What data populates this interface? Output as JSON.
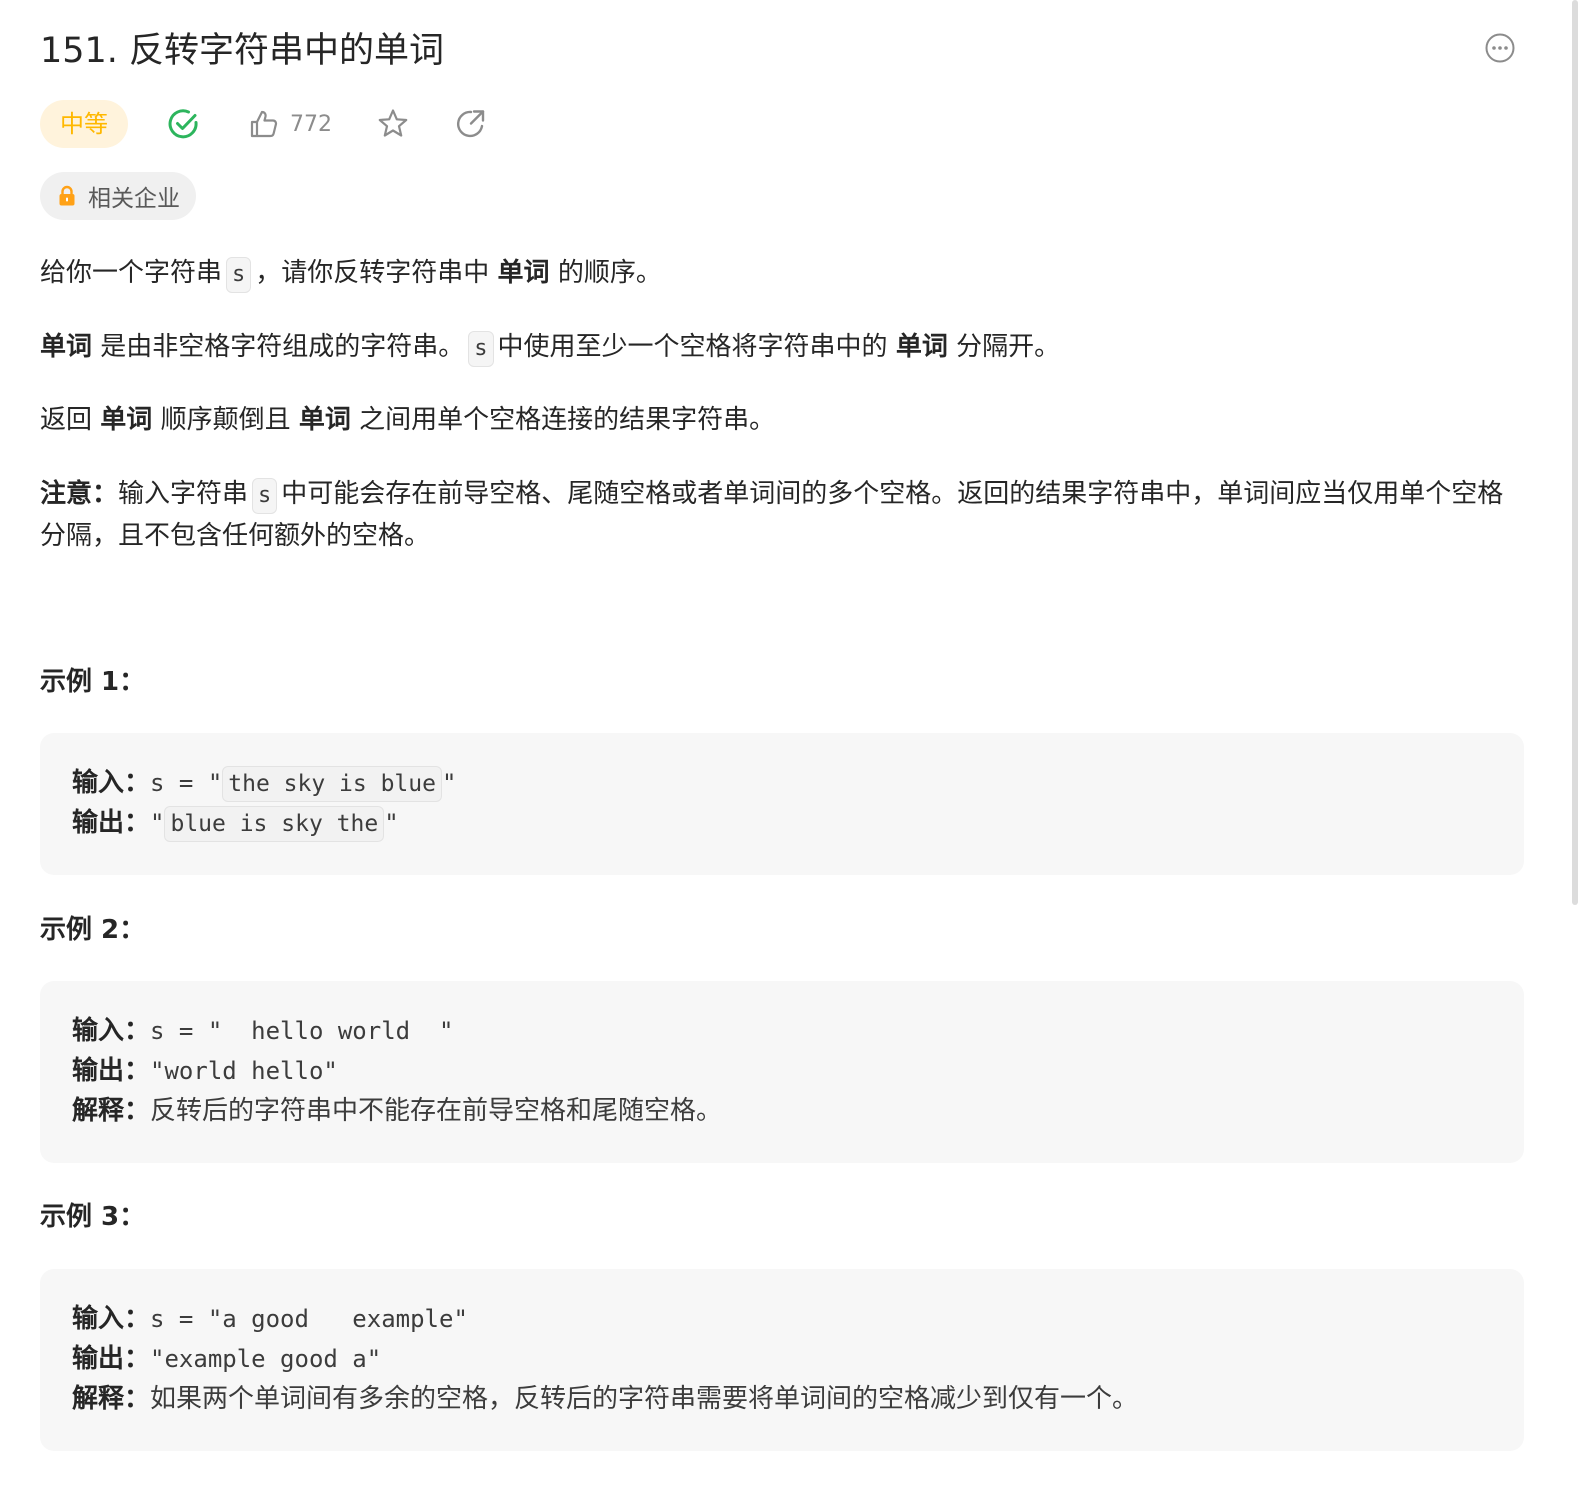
{
  "problem": {
    "title": "151. 反转字符串中的单词",
    "difficulty": "中等",
    "likes": "772",
    "company_tag": "相关企业"
  },
  "description": {
    "p1": {
      "a": "给你一个字符串",
      "code": "s",
      "b": "，请你反转字符串中",
      "bold": "单词",
      "c": "的顺序。"
    },
    "p2": {
      "bold1": "单词",
      "a": "是由非空格字符组成的字符串。",
      "code": "s",
      "b": "中使用至少一个空格将字符串中的",
      "bold2": "单词",
      "c": "分隔开。"
    },
    "p3": {
      "a": "返回",
      "bold1": "单词",
      "b": "顺序颠倒且",
      "bold2": "单词",
      "c": "之间用单个空格连接的结果字符串。"
    },
    "p4": {
      "bold": "注意：",
      "a": "输入字符串",
      "code": "s",
      "b": "中可能会存在前导空格、尾随空格或者单词间的多个空格。返回的结果字符串中，单词间应当仅用单个空格分隔，且不包含任何额外的空格。"
    }
  },
  "examples": [
    {
      "title": "示例 1：",
      "input_label": "输入：",
      "input_prefix": "s = \"",
      "input_value": "the sky is blue",
      "input_suffix": "\"",
      "output_label": "输出：",
      "output_prefix": "\"",
      "output_value": "blue is sky the",
      "output_suffix": "\""
    },
    {
      "title": "示例 2：",
      "input_label": "输入：",
      "input_text": "s = \"  hello world  \"",
      "output_label": "输出：",
      "output_text": "\"world hello\"",
      "explain_label": "解释：",
      "explain_text": "反转后的字符串中不能存在前导空格和尾随空格。"
    },
    {
      "title": "示例 3：",
      "input_label": "输入：",
      "input_text": "s = \"a good   example\"",
      "output_label": "输出：",
      "output_text": "\"example good a\"",
      "explain_label": "解释：",
      "explain_text": "如果两个单词间有多余的空格，反转后的字符串需要将单词间的空格减少到仅有一个。"
    }
  ],
  "colors": {
    "difficulty_text": "#ffb800",
    "difficulty_bg": "#fff3dc",
    "solved_green": "#2db55d",
    "lock_orange": "#ffa116",
    "icon_gray": "#8c8c8c"
  },
  "icons": {
    "more": "more-horizontal-icon",
    "solved": "check-circle-icon",
    "like": "thumbs-up-icon",
    "favorite": "star-icon",
    "share": "share-icon",
    "lock": "lock-icon"
  }
}
